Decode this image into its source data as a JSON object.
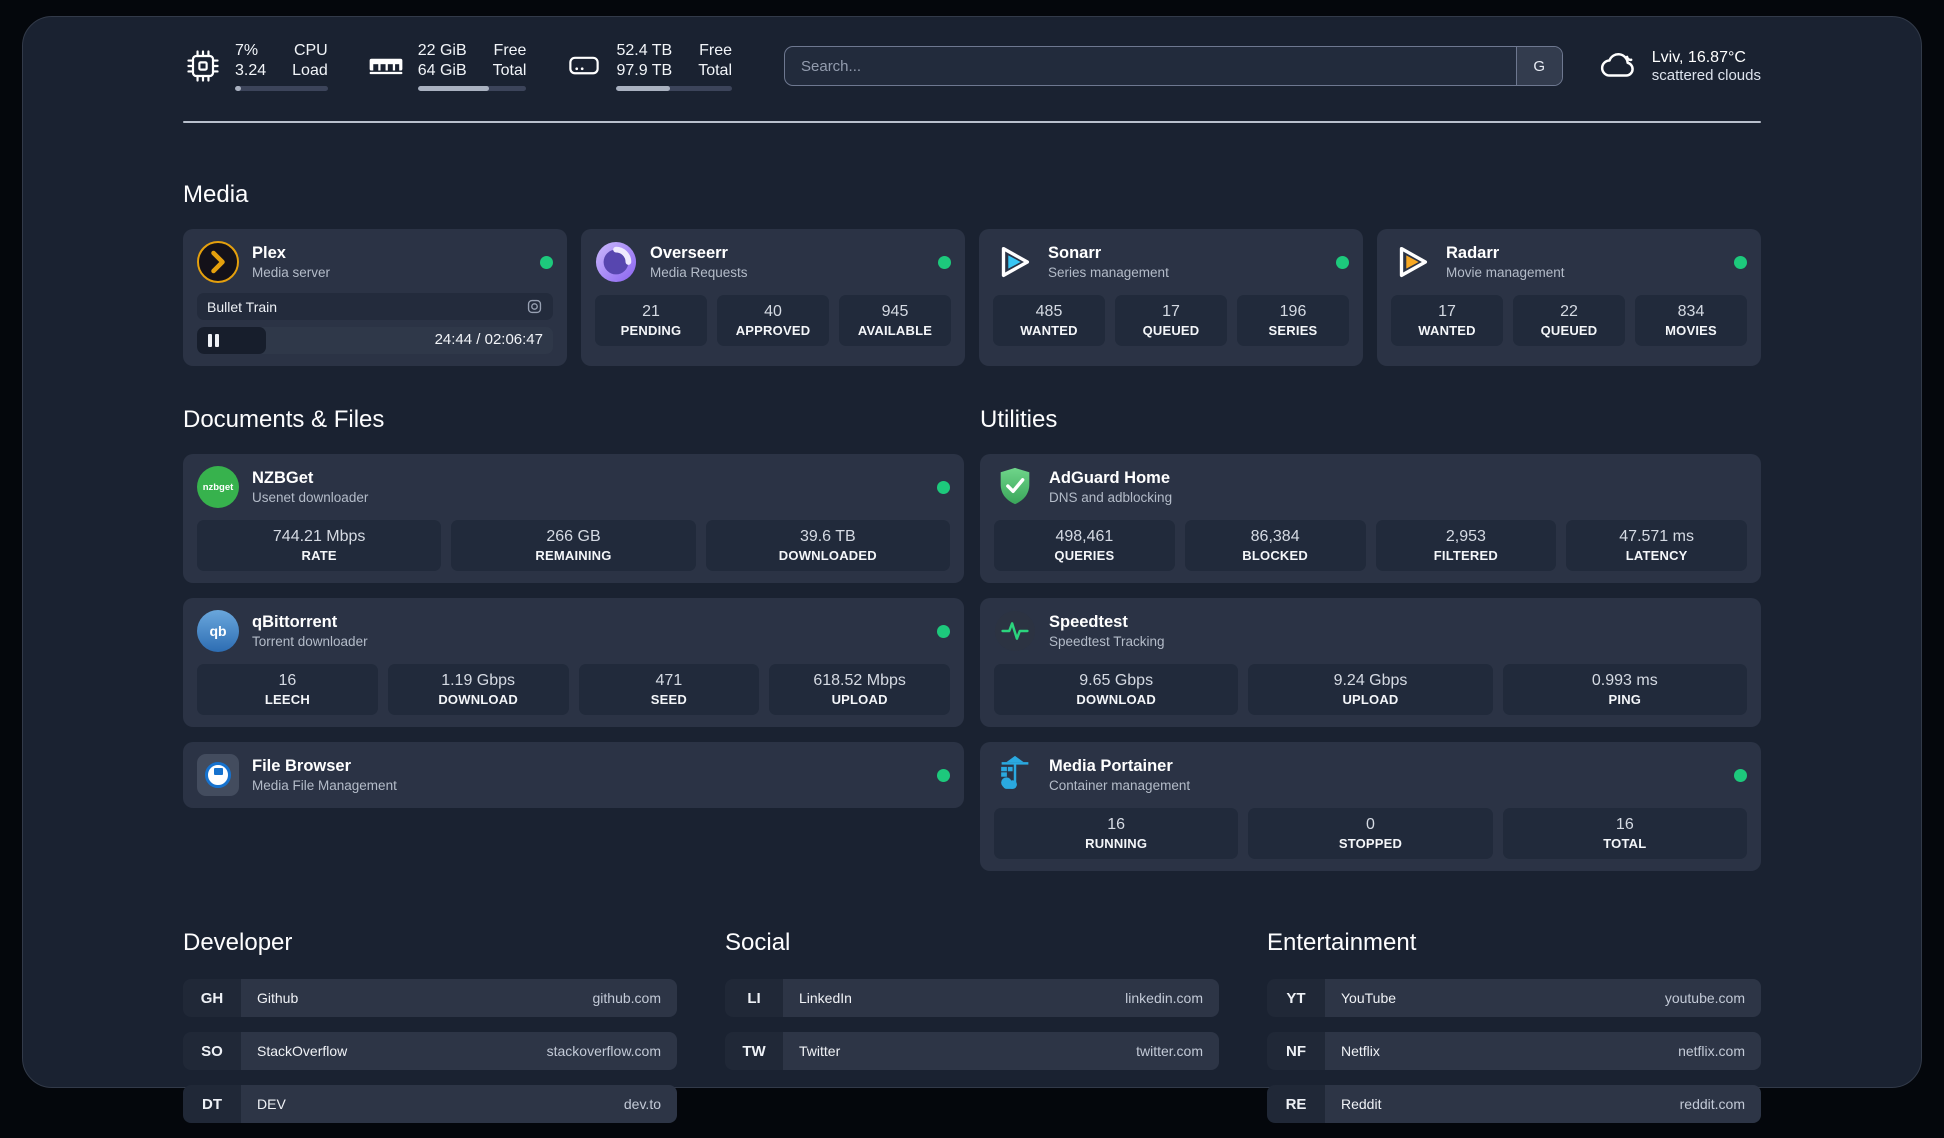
{
  "header": {
    "system": [
      {
        "icon": "cpu-icon",
        "value1": "7%",
        "value2": "3.24",
        "label1": "CPU",
        "label2": "Load",
        "progress": 7
      },
      {
        "icon": "ram-icon",
        "value1": "22 GiB",
        "value2": "64 GiB",
        "label1": "Free",
        "label2": "Total",
        "progress": 66
      },
      {
        "icon": "disk-icon",
        "value1": "52.4 TB",
        "value2": "97.9 TB",
        "label1": "Free",
        "label2": "Total",
        "progress": 46
      }
    ],
    "search": {
      "placeholder": "Search...",
      "engine": "G"
    },
    "weather": {
      "location_temp": "Lviv, 16.87°C",
      "condition": "scattered clouds"
    }
  },
  "media": {
    "title": "Media",
    "plex": {
      "name": "Plex",
      "subtitle": "Media server",
      "now_playing": "Bullet Train",
      "time": "24:44 / 02:06:47",
      "progress_pct": 19.5
    },
    "cards": [
      {
        "name": "Overseerr",
        "subtitle": "Media Requests",
        "stats": [
          {
            "value": "21",
            "label": "PENDING"
          },
          {
            "value": "40",
            "label": "APPROVED"
          },
          {
            "value": "945",
            "label": "AVAILABLE"
          }
        ]
      },
      {
        "name": "Sonarr",
        "subtitle": "Series management",
        "stats": [
          {
            "value": "485",
            "label": "WANTED"
          },
          {
            "value": "17",
            "label": "QUEUED"
          },
          {
            "value": "196",
            "label": "SERIES"
          }
        ]
      },
      {
        "name": "Radarr",
        "subtitle": "Movie management",
        "stats": [
          {
            "value": "17",
            "label": "WANTED"
          },
          {
            "value": "22",
            "label": "QUEUED"
          },
          {
            "value": "834",
            "label": "MOVIES"
          }
        ]
      }
    ]
  },
  "documents": {
    "title": "Documents & Files",
    "cards": [
      {
        "name": "NZBGet",
        "subtitle": "Usenet downloader",
        "stats": [
          {
            "value": "744.21 Mbps",
            "label": "RATE"
          },
          {
            "value": "266 GB",
            "label": "REMAINING"
          },
          {
            "value": "39.6 TB",
            "label": "DOWNLOADED"
          }
        ]
      },
      {
        "name": "qBittorrent",
        "subtitle": "Torrent downloader",
        "stats": [
          {
            "value": "16",
            "label": "LEECH"
          },
          {
            "value": "1.19 Gbps",
            "label": "DOWNLOAD"
          },
          {
            "value": "471",
            "label": "SEED"
          },
          {
            "value": "618.52 Mbps",
            "label": "UPLOAD"
          }
        ]
      },
      {
        "name": "File Browser",
        "subtitle": "Media File Management",
        "stats": []
      }
    ]
  },
  "utilities": {
    "title": "Utilities",
    "cards": [
      {
        "name": "AdGuard Home",
        "subtitle": "DNS and adblocking",
        "stats": [
          {
            "value": "498,461",
            "label": "QUERIES"
          },
          {
            "value": "86,384",
            "label": "BLOCKED"
          },
          {
            "value": "2,953",
            "label": "FILTERED"
          },
          {
            "value": "47.571 ms",
            "label": "LATENCY"
          }
        ]
      },
      {
        "name": "Speedtest",
        "subtitle": "Speedtest Tracking",
        "stats": [
          {
            "value": "9.65 Gbps",
            "label": "DOWNLOAD"
          },
          {
            "value": "9.24 Gbps",
            "label": "UPLOAD"
          },
          {
            "value": "0.993 ms",
            "label": "PING"
          }
        ]
      },
      {
        "name": "Media Portainer",
        "subtitle": "Container management",
        "stats": [
          {
            "value": "16",
            "label": "RUNNING"
          },
          {
            "value": "0",
            "label": "STOPPED"
          },
          {
            "value": "16",
            "label": "TOTAL"
          }
        ]
      }
    ]
  },
  "links": {
    "developer": {
      "title": "Developer",
      "items": [
        {
          "abbr": "GH",
          "name": "Github",
          "url": "github.com"
        },
        {
          "abbr": "SO",
          "name": "StackOverflow",
          "url": "stackoverflow.com"
        },
        {
          "abbr": "DT",
          "name": "DEV",
          "url": "dev.to"
        }
      ]
    },
    "social": {
      "title": "Social",
      "items": [
        {
          "abbr": "LI",
          "name": "LinkedIn",
          "url": "linkedin.com"
        },
        {
          "abbr": "TW",
          "name": "Twitter",
          "url": "twitter.com"
        }
      ]
    },
    "entertainment": {
      "title": "Entertainment",
      "items": [
        {
          "abbr": "YT",
          "name": "YouTube",
          "url": "youtube.com"
        },
        {
          "abbr": "NF",
          "name": "Netflix",
          "url": "netflix.com"
        },
        {
          "abbr": "RE",
          "name": "Reddit",
          "url": "reddit.com"
        }
      ]
    }
  },
  "colors": {
    "status_ok": "#1dc97c",
    "accent_plex": "#e5a00d"
  }
}
